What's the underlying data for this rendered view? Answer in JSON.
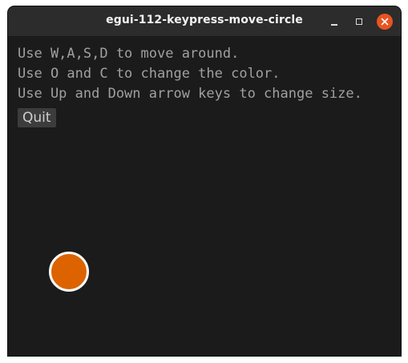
{
  "window": {
    "title": "egui-112-keypress-move-circle"
  },
  "instructions": [
    "Use W,A,S,D to move around.",
    "Use O and C to change the color.",
    "Use Up and Down arrow keys to change size."
  ],
  "quit_button": {
    "label": "Quit"
  },
  "circle": {
    "fill_color": "#dc6300",
    "border_color": "#ffffff"
  },
  "icons": {
    "minimize": "minimize-icon",
    "maximize": "maximize-icon",
    "close": "close-icon"
  },
  "colors": {
    "background": "#1b1b1b",
    "titlebar": "#2c2c2c",
    "close_button": "#e95420",
    "text": "#a0a0a0"
  }
}
